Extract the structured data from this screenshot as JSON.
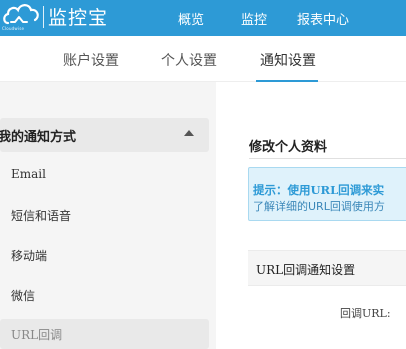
{
  "header": {
    "logo_text": "监控宝",
    "logo_small_text": "Cloudwise",
    "nav": [
      {
        "label": "概览"
      },
      {
        "label": "监控"
      },
      {
        "label": "报表中心"
      }
    ],
    "background_color": "#2d9ad6"
  },
  "subtabs": [
    {
      "label": "账户设置",
      "active": false
    },
    {
      "label": "个人设置",
      "active": false
    },
    {
      "label": "通知设置",
      "active": true
    }
  ],
  "sidebar": {
    "title": "我的通知方式",
    "expanded": true,
    "items": [
      {
        "label": "Email",
        "active": false
      },
      {
        "label": "短信和语音",
        "active": false
      },
      {
        "label": "移动端",
        "active": false
      },
      {
        "label": "微信",
        "active": false
      },
      {
        "label": "URL回调",
        "active": true
      }
    ]
  },
  "main": {
    "section_title": "修改个人资料",
    "tip": {
      "title": "提示：使用URL回调来实",
      "description": "了解详细的URL回调使用方"
    },
    "row_label": "URL回调通知设置",
    "form_label": "回调URL:"
  },
  "colors": {
    "accent": "#2d9ad6",
    "tip_background": "#dff2fb",
    "tip_border": "#a9d9f0"
  }
}
